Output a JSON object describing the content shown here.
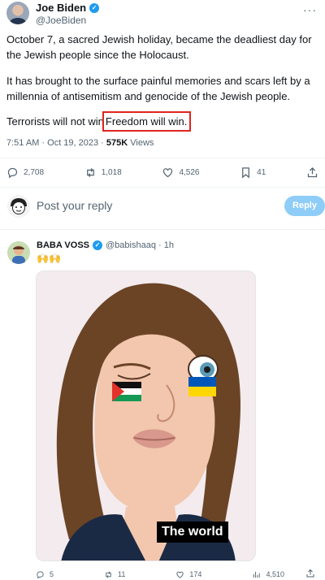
{
  "tweet": {
    "author_name": "Joe Biden",
    "author_handle": "@JoeBiden",
    "paragraph1": "October 7, a sacred Jewish holiday, became the deadliest day for the Jewish people since the Holocaust.",
    "paragraph2": "It has brought to the surface painful memories and scars left by a millennia of antisemitism and genocide of the Jewish people.",
    "paragraph3_start": "Terrorists will not win",
    "paragraph3_highlight": "Freedom will win.",
    "timestamp": "7:51 AM · Oct 19, 2023 · ",
    "views_count": "575K",
    "views_label": " Views",
    "stats": {
      "replies": "2,708",
      "retweets": "1,018",
      "likes": "4,526",
      "bookmarks": "41"
    }
  },
  "reply_box": {
    "placeholder": "Post your reply",
    "button_label": "Reply"
  },
  "reply": {
    "author_name": "BABA VOSS",
    "author_handle": "@babishaaq · 1h",
    "text": "🙌🙌",
    "media_caption": "The world",
    "stats": {
      "replies": "5",
      "retweets": "11",
      "likes": "174",
      "views": "4,510"
    }
  },
  "colors": {
    "accent": "#1d9bf0",
    "reply_button_disabled": "#8ecdf8",
    "highlight_border": "#e0241e"
  }
}
